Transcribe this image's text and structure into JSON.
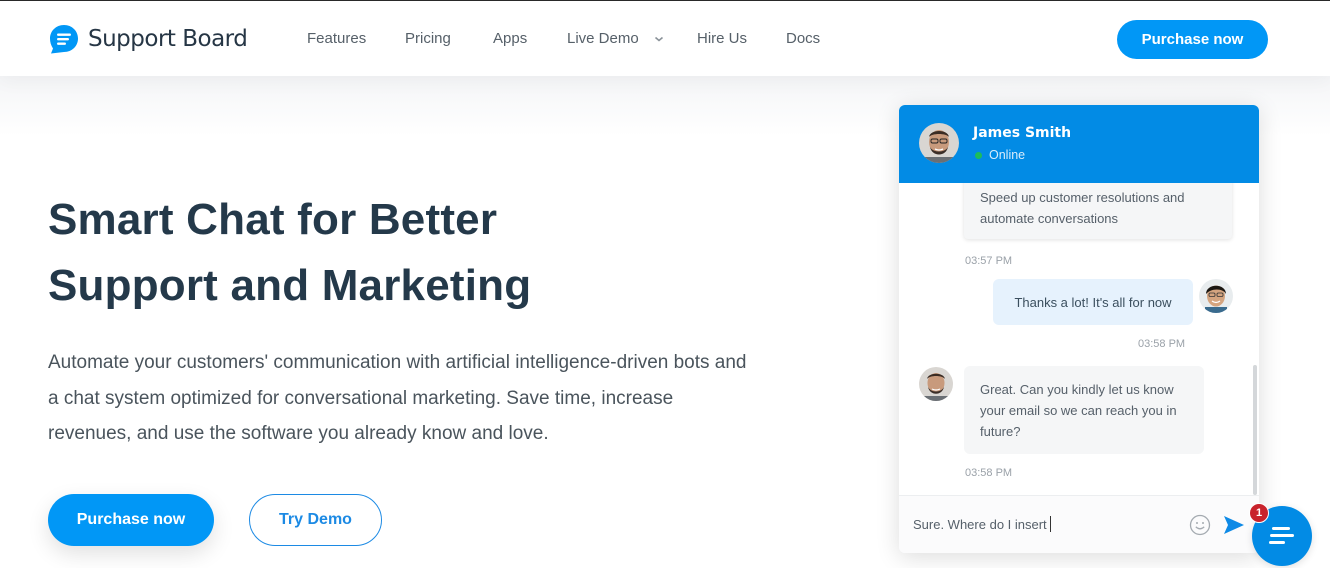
{
  "header": {
    "brand": "Support Board",
    "nav": [
      {
        "label": "Features"
      },
      {
        "label": "Pricing"
      },
      {
        "label": "Apps"
      },
      {
        "label": "Live Demo",
        "has_dropdown": true
      },
      {
        "label": "Hire Us"
      },
      {
        "label": "Docs"
      }
    ],
    "cta_label": "Purchase now"
  },
  "hero": {
    "title_line1": "Smart Chat for Better",
    "title_line2": "Support and Marketing",
    "description": "Automate your customers' communication with artificial intelligence-driven bots and a chat system optimized for conversational marketing. Save time, increase revenues, and use the software you already know and love.",
    "primary_button": "Purchase now",
    "secondary_button": "Try Demo"
  },
  "chat": {
    "agent_name": "James Smith",
    "agent_status": "Online",
    "messages": [
      {
        "from": "agent",
        "text": "Speed up customer resolutions and automate conversations",
        "time": "03:57 PM"
      },
      {
        "from": "user",
        "text": "Thanks a lot! It's all for now",
        "time": "03:58 PM"
      },
      {
        "from": "agent",
        "text": "Great. Can you kindly let us know your email so we can reach you in future?",
        "time": "03:58 PM"
      }
    ],
    "input_value": "Sure. Where do I insert",
    "icons": {
      "emoji": "smiley-icon",
      "send": "send-icon"
    }
  },
  "launcher": {
    "badge_count": "1"
  },
  "colors": {
    "brand_blue": "#0197f6",
    "chat_header": "#028be5",
    "heading": "#24394a",
    "badge_red": "#c8232c",
    "online_green": "#1dbd5a"
  }
}
